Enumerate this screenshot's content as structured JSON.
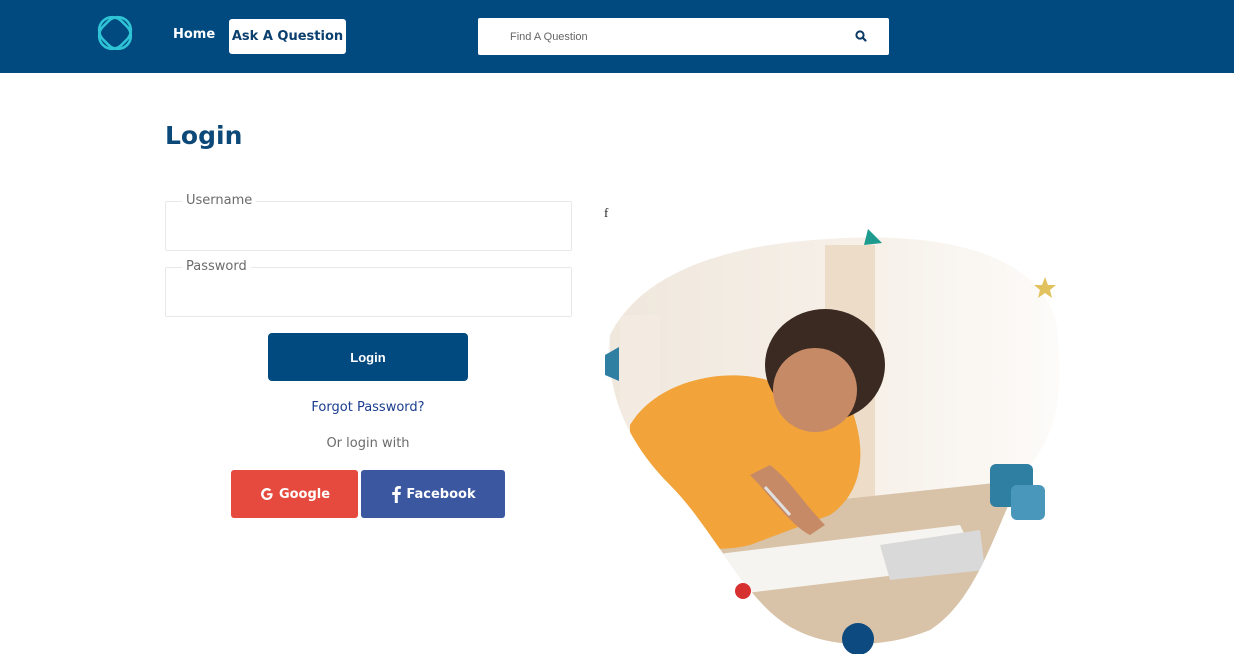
{
  "header": {
    "logo_icon": "interlocking-rings-icon",
    "nav_home": "Home",
    "nav_ask": "Ask A Question",
    "search_placeholder": "Find A Question",
    "search_icon": "search-icon"
  },
  "login": {
    "title": "Login",
    "username_label": "Username",
    "username_value": "",
    "password_label": "Password",
    "password_value": "",
    "submit_label": "Login",
    "forgot_label": "Forgot Password?",
    "or_text": "Or login with",
    "google_label": "Google",
    "facebook_label": "Facebook"
  },
  "illustration": {
    "stray_text": "f",
    "photo_description_icon": "student-writing-photo"
  },
  "colors": {
    "header_bg": "#004a80",
    "primary": "#004a80",
    "google": "#e64a3e",
    "facebook": "#3b57a0",
    "title": "#0d4978",
    "link": "#1a3d8f"
  }
}
